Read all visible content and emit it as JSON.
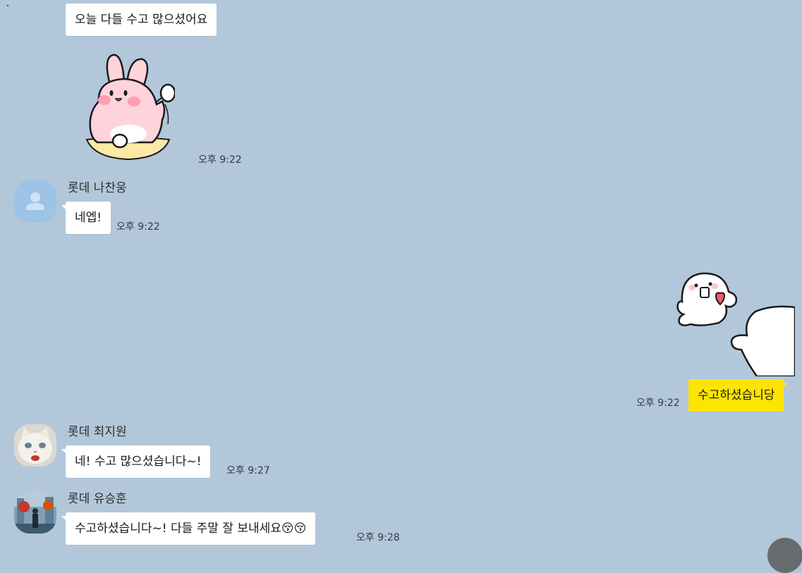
{
  "messages": {
    "m1": {
      "text": "오늘 다들 수고 많으셨어요"
    },
    "m2": {
      "time": "오후 9:22"
    },
    "m3": {
      "sender": "롯데 나찬웅",
      "text": "네엡!",
      "time": "오후 9:22"
    },
    "m4": {
      "time": "오후 9:22"
    },
    "m5": {
      "text": "수고하셨습니당",
      "time": "오후 9:22"
    },
    "m6": {
      "sender": "롯데 최지원",
      "text": "네! 수고 많으셨습니다~!",
      "time": "오후 9:27"
    },
    "m7": {
      "sender": "롯데 유승훈",
      "text": "수고하셨습니다~! 다들 주말 잘 보내세요😚😚",
      "time": "오후 9:28"
    }
  },
  "colors": {
    "background": "#b2c7da",
    "my_bubble": "#fee500",
    "other_bubble": "#ffffff"
  },
  "icons": {
    "default_avatar": "person-icon",
    "scroll_down": "scroll-down-button"
  }
}
